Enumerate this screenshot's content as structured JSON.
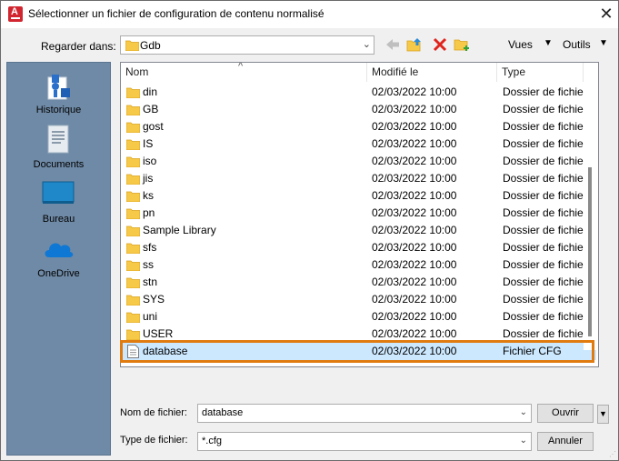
{
  "window": {
    "title": "Sélectionner un fichier de configuration de contenu normalisé",
    "close_glyph": "✕"
  },
  "lookin": {
    "label": "Regarder dans:",
    "value": "Gdb"
  },
  "toolbar": {
    "views_label": "Vues",
    "tools_label": "Outils"
  },
  "places": [
    {
      "label": "Historique",
      "icon": "history-icon"
    },
    {
      "label": "Documents",
      "icon": "documents-icon"
    },
    {
      "label": "Bureau",
      "icon": "desktop-icon"
    },
    {
      "label": "OneDrive",
      "icon": "onedrive-icon"
    }
  ],
  "columns": {
    "name": "Nom",
    "modified": "Modifié le",
    "type": "Type"
  },
  "files": [
    {
      "name": "din",
      "date": "02/03/2022 10:00",
      "type": "Dossier de fichiers",
      "kind": "folder"
    },
    {
      "name": "GB",
      "date": "02/03/2022 10:00",
      "type": "Dossier de fichiers",
      "kind": "folder"
    },
    {
      "name": "gost",
      "date": "02/03/2022 10:00",
      "type": "Dossier de fichiers",
      "kind": "folder"
    },
    {
      "name": "IS",
      "date": "02/03/2022 10:00",
      "type": "Dossier de fichiers",
      "kind": "folder"
    },
    {
      "name": "iso",
      "date": "02/03/2022 10:00",
      "type": "Dossier de fichiers",
      "kind": "folder"
    },
    {
      "name": "jis",
      "date": "02/03/2022 10:00",
      "type": "Dossier de fichiers",
      "kind": "folder"
    },
    {
      "name": "ks",
      "date": "02/03/2022 10:00",
      "type": "Dossier de fichiers",
      "kind": "folder"
    },
    {
      "name": "pn",
      "date": "02/03/2022 10:00",
      "type": "Dossier de fichiers",
      "kind": "folder"
    },
    {
      "name": "Sample Library",
      "date": "02/03/2022 10:00",
      "type": "Dossier de fichiers",
      "kind": "folder"
    },
    {
      "name": "sfs",
      "date": "02/03/2022 10:00",
      "type": "Dossier de fichiers",
      "kind": "folder"
    },
    {
      "name": "ss",
      "date": "02/03/2022 10:00",
      "type": "Dossier de fichiers",
      "kind": "folder"
    },
    {
      "name": "stn",
      "date": "02/03/2022 10:00",
      "type": "Dossier de fichiers",
      "kind": "folder"
    },
    {
      "name": "SYS",
      "date": "02/03/2022 10:00",
      "type": "Dossier de fichiers",
      "kind": "folder"
    },
    {
      "name": "uni",
      "date": "02/03/2022 10:00",
      "type": "Dossier de fichiers",
      "kind": "folder"
    },
    {
      "name": "USER",
      "date": "02/03/2022 10:00",
      "type": "Dossier de fichiers",
      "kind": "folder"
    },
    {
      "name": "database",
      "date": "02/03/2022 10:00",
      "type": "Fichier CFG",
      "kind": "file",
      "selected": true
    }
  ],
  "filename": {
    "label": "Nom de fichier:",
    "value": "database"
  },
  "filetype": {
    "label": "Type de fichier:",
    "value": "*.cfg"
  },
  "buttons": {
    "open": "Ouvrir",
    "cancel": "Annuler"
  },
  "colors": {
    "selection": "#cce8ff",
    "highlight_outline": "#e07b10",
    "places_bg": "#6f8aa6",
    "folder": "#f7c948"
  }
}
